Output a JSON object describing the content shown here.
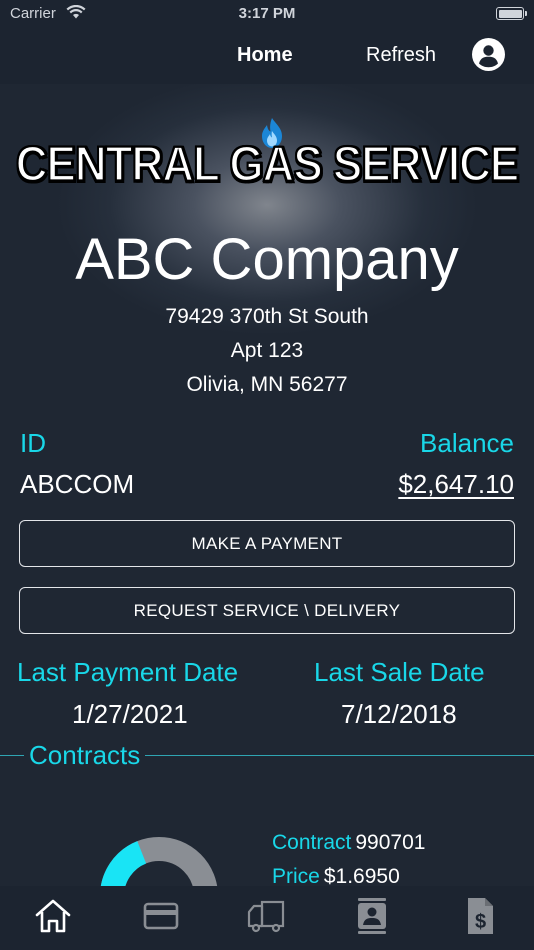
{
  "status_bar": {
    "carrier": "Carrier",
    "time": "3:17 PM"
  },
  "nav": {
    "home": "Home",
    "refresh": "Refresh",
    "account_icon": "account-circle-icon"
  },
  "brand": {
    "logo_text": "CENTRAL GAS SERVICE",
    "logo_icon": "flame-icon"
  },
  "customer": {
    "name": "ABC Company",
    "address_line1": "79429 370th St South",
    "address_line2": "Apt 123",
    "address_line3": "Olivia, MN 56277"
  },
  "account": {
    "id_label": "ID",
    "id_value": "ABCCOM",
    "balance_label": "Balance",
    "balance_value": "$2,647.10"
  },
  "actions": {
    "make_payment": "MAKE A PAYMENT",
    "request_service": "REQUEST SERVICE \\ DELIVERY"
  },
  "dates": {
    "last_payment_label": "Last Payment Date",
    "last_payment_value": "1/27/2021",
    "last_sale_label": "Last Sale Date",
    "last_sale_value": "7/12/2018"
  },
  "contracts": {
    "title": "Contracts",
    "contract_label": "Contract",
    "contract_value": "990701",
    "price_label": "Price",
    "price_value": "$1.6950",
    "usage_fraction": 0.38
  },
  "tabs": [
    {
      "name": "home-icon"
    },
    {
      "name": "credit-card-icon"
    },
    {
      "name": "delivery-truck-icon"
    },
    {
      "name": "contact-card-icon"
    },
    {
      "name": "invoice-dollar-icon"
    }
  ],
  "colors": {
    "accent": "#19d7e8",
    "background": "#1e2633",
    "bar": "#1c2430"
  }
}
